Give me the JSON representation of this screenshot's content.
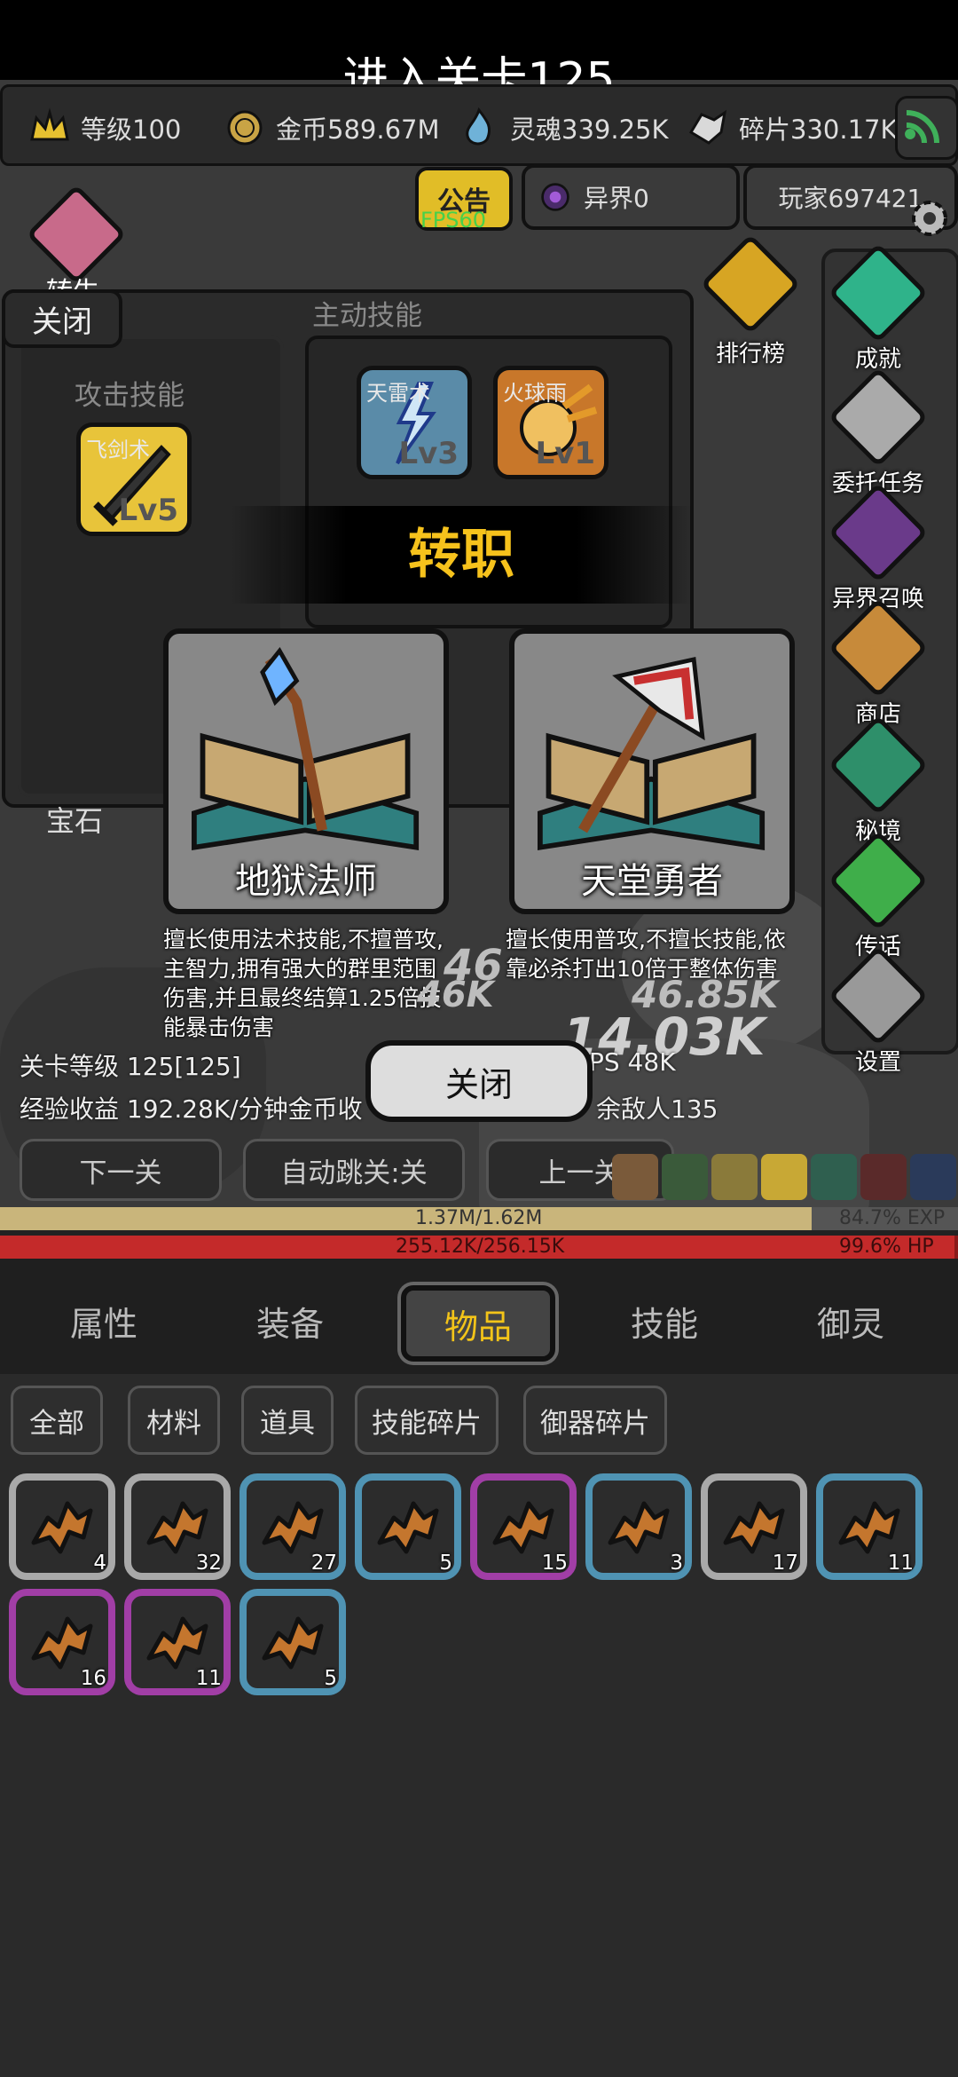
{
  "header": {
    "stage_title": "进入关卡125",
    "fps": "FPS60",
    "notice_label": "公告",
    "otherworld": "异界0",
    "player": "玩家697421"
  },
  "resources": {
    "level": "等级100",
    "gold": "金币589.67M",
    "soul": "灵魂339.25K",
    "fragments": "碎片330.17K"
  },
  "skill_panel": {
    "close_label": "关闭",
    "active_title": "主动技能",
    "attack_title": "攻击技能",
    "skills": [
      {
        "name": "飞剑术",
        "level": "Lv5"
      },
      {
        "name": "天雷术",
        "level": "Lv3"
      },
      {
        "name": "火球雨",
        "level": "Lv1"
      }
    ],
    "gem_label": "宝石",
    "left_peek": "转生"
  },
  "side_menu": [
    {
      "label": "排行榜"
    },
    {
      "label": "成就"
    },
    {
      "label": "委托任务"
    },
    {
      "label": "异界召唤"
    },
    {
      "label": "商店"
    },
    {
      "label": "秘境"
    },
    {
      "label": "传话"
    },
    {
      "label": "设置"
    }
  ],
  "job_change": {
    "title": "转职",
    "options": [
      {
        "name": "地狱法师",
        "desc": "擅长使用法术技能,不擅普攻,主智力,拥有强大的群里范围伤害,并且最终结算1.25倍技能暴击伤害"
      },
      {
        "name": "天堂勇者",
        "desc": "擅长使用普攻,不擅长技能,依靠必杀打出10倍于整体伤害"
      }
    ],
    "close_label": "关闭"
  },
  "damage_numbers": [
    "46",
    "46K",
    "46.85K",
    "14.03K"
  ],
  "stats": {
    "stage_level": "关卡等级 125[125]",
    "exp_gain": "经验收益 192.28K/分钟金币收",
    "dps": "PS 48K",
    "enemies": "余敌人135"
  },
  "nav": {
    "next": "下一关",
    "auto": "自动跳关:关",
    "prev": "上一关"
  },
  "bars": {
    "exp_text": "1.37M/1.62M",
    "exp_pct": "84.7% EXP",
    "exp_value": 0.847,
    "hp_text": "255.12K/256.15K",
    "hp_pct": "99.6%  HP",
    "hp_value": 0.996
  },
  "tabs": [
    {
      "label": "属性"
    },
    {
      "label": "装备"
    },
    {
      "label": "物品"
    },
    {
      "label": "技能"
    },
    {
      "label": "御灵"
    }
  ],
  "filters": [
    {
      "label": "全部"
    },
    {
      "label": "材料"
    },
    {
      "label": "道具"
    },
    {
      "label": "技能碎片"
    },
    {
      "label": "御器碎片"
    }
  ],
  "items": [
    {
      "count": "4",
      "rarity": "white"
    },
    {
      "count": "32",
      "rarity": "white"
    },
    {
      "count": "27",
      "rarity": "blue"
    },
    {
      "count": "5",
      "rarity": "blue"
    },
    {
      "count": "15",
      "rarity": "purple"
    },
    {
      "count": "3",
      "rarity": "blue"
    },
    {
      "count": "17",
      "rarity": "white"
    },
    {
      "count": "11",
      "rarity": "blue"
    },
    {
      "count": "16",
      "rarity": "purple"
    },
    {
      "count": "11",
      "rarity": "purple"
    },
    {
      "count": "5",
      "rarity": "blue"
    }
  ],
  "colors": {
    "white": "#a9a9a9",
    "blue": "#4f93b3",
    "purple": "#a13ea6",
    "accent": "#f3c419"
  }
}
